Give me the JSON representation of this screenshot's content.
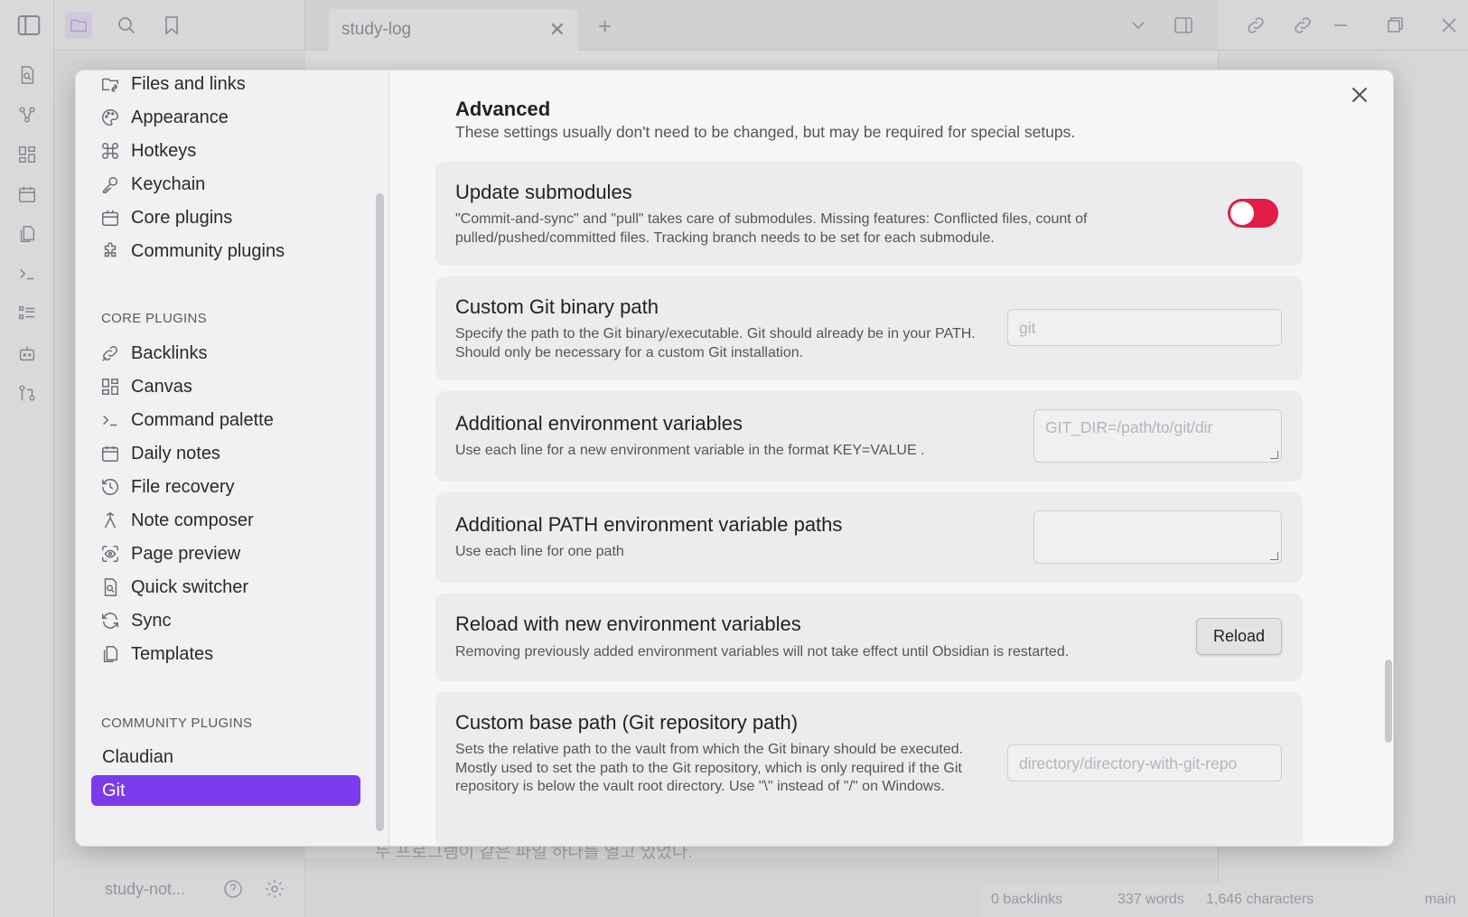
{
  "background": {
    "tab_title": "study-log",
    "vault_name": "study-not...",
    "editor_line": "누 프로그램이 같은 파일 하나를 열고 있었다.",
    "status": {
      "backlinks": "0 backlinks",
      "words": "337 words",
      "characters": "1,646 characters",
      "branch": "main"
    }
  },
  "sidebar": {
    "options_items": [
      {
        "label": "Files and links",
        "icon": "folder-link-icon"
      },
      {
        "label": "Appearance",
        "icon": "palette-icon"
      },
      {
        "label": "Hotkeys",
        "icon": "command-icon"
      },
      {
        "label": "Keychain",
        "icon": "key-icon"
      },
      {
        "label": "Core plugins",
        "icon": "plug-box-icon"
      },
      {
        "label": "Community plugins",
        "icon": "puzzle-icon"
      }
    ],
    "core_heading": "CORE PLUGINS",
    "core_items": [
      {
        "label": "Backlinks",
        "icon": "backlink-icon"
      },
      {
        "label": "Canvas",
        "icon": "canvas-icon"
      },
      {
        "label": "Command palette",
        "icon": "terminal-icon"
      },
      {
        "label": "Daily notes",
        "icon": "calendar-icon"
      },
      {
        "label": "File recovery",
        "icon": "history-icon"
      },
      {
        "label": "Note composer",
        "icon": "merge-icon"
      },
      {
        "label": "Page preview",
        "icon": "scan-eye-icon"
      },
      {
        "label": "Quick switcher",
        "icon": "file-search-icon"
      },
      {
        "label": "Sync",
        "icon": "sync-icon"
      },
      {
        "label": "Templates",
        "icon": "files-icon"
      }
    ],
    "community_heading": "COMMUNITY PLUGINS",
    "community_items": [
      {
        "label": "Claudian"
      },
      {
        "label": "Git",
        "active": true
      }
    ]
  },
  "content": {
    "section_title": "Advanced",
    "section_desc": "These settings usually don't need to be changed, but may be required for special setups.",
    "settings": {
      "submodules": {
        "title": "Update submodules",
        "desc": "\"Commit-and-sync\" and \"pull\" takes care of submodules. Missing features: Conflicted files, count of pulled/pushed/committed files. Tracking branch needs to be set for each submodule.",
        "enabled": true,
        "toggle_color": "#e11d48"
      },
      "git_binary": {
        "title": "Custom Git binary path",
        "desc": "Specify the path to the Git binary/executable. Git should already be in your PATH. Should only be necessary for a custom Git installation.",
        "value": "",
        "placeholder": "git"
      },
      "env_vars": {
        "title": "Additional environment variables",
        "desc": "Use each line for a new environment variable in the format KEY=VALUE .",
        "value": "",
        "placeholder": "GIT_DIR=/path/to/git/dir"
      },
      "path_vars": {
        "title": "Additional PATH environment variable paths",
        "desc": "Use each line for one path",
        "value": "",
        "placeholder": ""
      },
      "reload": {
        "title": "Reload with new environment variables",
        "desc": "Removing previously added environment variables will not take effect until Obsidian is restarted.",
        "button_label": "Reload"
      },
      "base_path": {
        "title": "Custom base path (Git repository path)",
        "desc": "Sets the relative path to the vault from which the Git binary should be executed. Mostly used to set the path to the Git repository, which is only required if the Git repository is below the vault root directory. Use \"\\\" instead of \"/\" on Windows.",
        "value": "",
        "placeholder": "directory/directory-with-git-repo"
      }
    }
  },
  "colors": {
    "accent": "#7c3aed",
    "toggle_on": "#e11d48"
  }
}
